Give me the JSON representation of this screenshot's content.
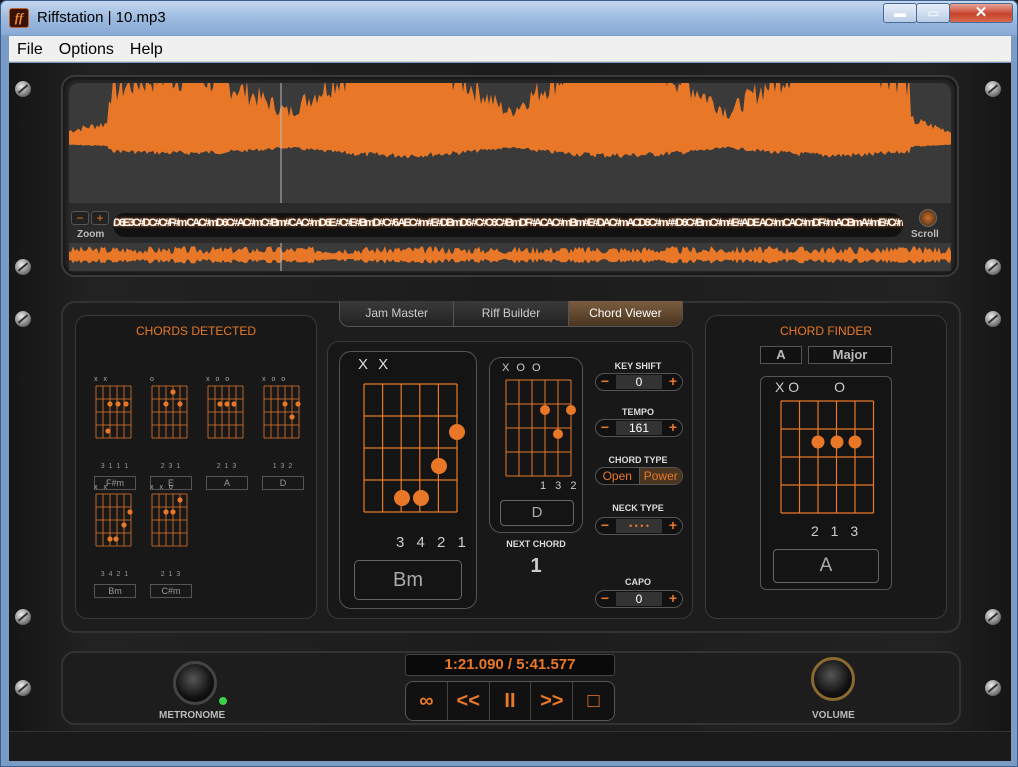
{
  "window": {
    "title": "Riffstation | 10.mp3",
    "icon_text": "ff",
    "minimize": "▬",
    "maximize": "▭",
    "close": "✕"
  },
  "menu": [
    "File",
    "Options",
    "Help"
  ],
  "waveform": {
    "zoom_label": "Zoom",
    "scroll_label": "Scroll",
    "zoom_minus": "−",
    "zoom_plus": "+",
    "chord_strip": "D6E3C#DC#C#F#m CAC#mD6C# AC#mC#Bm#C AC#mD6E #C#E#BmD#C#6 AEC#m#E#DBmD6 #C#C6C#BmDF#ACAC#mBm#E#DAC#mACD6C#m ##D6C#BmC#m#E#ADE AC#mCAC#mDF#mACBmA#mE#C#m BmEC#mAC#mBmC#C#mDF#C#"
  },
  "tabs": [
    "Jam Master",
    "Riff Builder",
    "Chord Viewer"
  ],
  "chords_detected": {
    "title": "CHORDS DETECTED",
    "chords": [
      {
        "name": "F#m",
        "marks": "x x",
        "fingers": "3 1 1 1"
      },
      {
        "name": "E",
        "marks": "o",
        "fingers": "2 3 1"
      },
      {
        "name": "A",
        "marks": "x o     o",
        "fingers": "2 1 3"
      },
      {
        "name": "D",
        "marks": "x o o",
        "fingers": "1 3 2"
      },
      {
        "name": "Bm",
        "marks": "x x",
        "fingers": "3 4 2 1"
      },
      {
        "name": "C#m",
        "marks": "x x     o",
        "fingers": "2 1 3"
      }
    ]
  },
  "current_chord": {
    "marks": "X X",
    "fingers": "3 4 2 1",
    "name": "Bm"
  },
  "next_chord": {
    "marks": "X O O",
    "fingers": "1 3 2",
    "name": "D",
    "label": "NEXT CHORD",
    "count": "1"
  },
  "controls": {
    "key_shift": {
      "label": "KEY SHIFT",
      "value": "0"
    },
    "tempo": {
      "label": "TEMPO",
      "value": "161"
    },
    "chord_type": {
      "label": "CHORD TYPE",
      "options": [
        "Open",
        "Power"
      ]
    },
    "neck_type": {
      "label": "NECK TYPE",
      "value": "• • • •"
    },
    "capo": {
      "label": "CAPO",
      "value": "0"
    },
    "minus": "−",
    "plus": "+"
  },
  "chord_finder": {
    "title": "CHORD FINDER",
    "root": "A",
    "quality": "Major",
    "marks": "X O         O",
    "fingers": "2 1 3",
    "name": "A"
  },
  "transport": {
    "time": "1:21.090 / 5:41.577",
    "buttons": [
      "∞",
      "<<",
      "II",
      ">>",
      "□"
    ],
    "metronome_label": "METRONOME",
    "volume_label": "VOLUME"
  },
  "colors": {
    "accent": "#e87828",
    "background": "#1c1c1c"
  }
}
